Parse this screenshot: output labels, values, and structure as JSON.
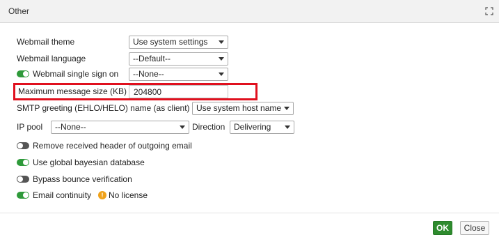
{
  "dialog": {
    "title": "Other"
  },
  "fields": {
    "webmail_theme": {
      "label": "Webmail theme",
      "value": "Use system settings"
    },
    "webmail_language": {
      "label": "Webmail language",
      "value": "--Default--"
    },
    "webmail_sso": {
      "label": "Webmail single sign on",
      "enabled": true,
      "value": "--None--"
    },
    "max_message_size": {
      "label": "Maximum message size (KB)",
      "value": "204800"
    },
    "smtp_greeting": {
      "label": "SMTP greeting (EHLO/HELO) name (as client)",
      "value": "Use system host name"
    },
    "ip_pool": {
      "label": "IP pool",
      "value": "--None--"
    },
    "direction": {
      "label": "Direction",
      "value": "Delivering"
    }
  },
  "toggles": {
    "remove_received_header": {
      "label": "Remove received header of outgoing email",
      "enabled": false
    },
    "global_bayesian": {
      "label": "Use global bayesian database",
      "enabled": true
    },
    "bypass_bounce": {
      "label": "Bypass bounce verification",
      "enabled": false
    },
    "email_continuity": {
      "label": "Email continuity",
      "enabled": true,
      "note": "No license"
    }
  },
  "footer": {
    "ok_label": "OK",
    "close_label": "Close"
  },
  "colors": {
    "toggle_on": "#2e9a3a",
    "toggle_off": "#555555",
    "highlight": "#e0101e",
    "ok_button": "#2e8b2e",
    "warning": "#f0a21a"
  }
}
